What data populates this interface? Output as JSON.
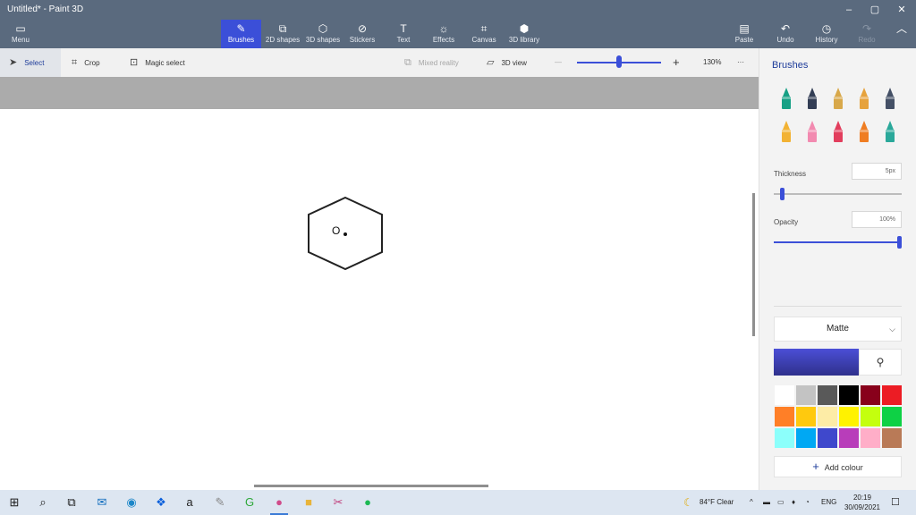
{
  "titlebar": {
    "title": "Untitled* - Paint 3D",
    "minimize": "–",
    "maximize": "▢",
    "close": "✕"
  },
  "ribbon": {
    "menu": "Menu",
    "tools": [
      "Brushes",
      "2D shapes",
      "3D shapes",
      "Stickers",
      "Text",
      "Effects",
      "Canvas",
      "3D library"
    ],
    "paste": "Paste",
    "undo": "Undo",
    "history": "History",
    "redo": "Redo"
  },
  "toolbar": {
    "select": "Select",
    "crop": "Crop",
    "magic_select": "Magic select",
    "mixed_reality": "Mixed reality",
    "view_3d": "3D view",
    "zoom_minus": "—",
    "zoom_plus": "+",
    "zoom_level": "130%",
    "more": "···",
    "zoom_level_fraction": 0.49
  },
  "canvas": {
    "drawing_text": "O"
  },
  "panel": {
    "title": "Brushes",
    "brushes": [
      {
        "name": "marker-icon",
        "color": "#16a085"
      },
      {
        "name": "calligraphy-pen-icon",
        "color": "#333e55"
      },
      {
        "name": "oil-brush-icon",
        "color": "#d8a84a"
      },
      {
        "name": "watercolor-icon",
        "color": "#e6a23c"
      },
      {
        "name": "pixel-pen-icon",
        "color": "#445066"
      },
      {
        "name": "pencil-icon",
        "color": "#f2b233"
      },
      {
        "name": "eraser-icon",
        "color": "#f28ab0"
      },
      {
        "name": "crayon-icon",
        "color": "#e23e5d"
      },
      {
        "name": "spray-can-icon",
        "color": "#ef7d22"
      },
      {
        "name": "fill-icon",
        "color": "#2aa89a"
      }
    ],
    "thickness_label": "Thickness",
    "thickness_value": "5px",
    "thickness_fraction": 0.05,
    "opacity_label": "Opacity",
    "opacity_value": "100%",
    "opacity_fraction": 1.0,
    "finish": "Matte",
    "current_colour": "#3a3cb5",
    "palette": [
      "#ffffff",
      "#c3c3c3",
      "#595959",
      "#000000",
      "#88001b",
      "#ec1c24",
      "#ff7f27",
      "#ffc90e",
      "#fdeca6",
      "#fff200",
      "#c4ff0e",
      "#0ed145",
      "#8cfffb",
      "#00a8f3",
      "#3f48cc",
      "#b83dba",
      "#ffaec8",
      "#b97a57"
    ],
    "add_colour": "Add colour"
  },
  "taskbar": {
    "apps": [
      "windows-start-icon",
      "search-icon",
      "task-view-icon",
      "mail-icon",
      "edge-icon",
      "dropbox-icon",
      "amazon-icon",
      "paint-brush-app-icon",
      "gmail-g-icon",
      "paint-3d-icon",
      "file-explorer-icon",
      "snip-icon",
      "spotify-icon"
    ],
    "weather": "84°F Clear",
    "language": "ENG",
    "time": "20:19",
    "date": "30/09/2021"
  }
}
